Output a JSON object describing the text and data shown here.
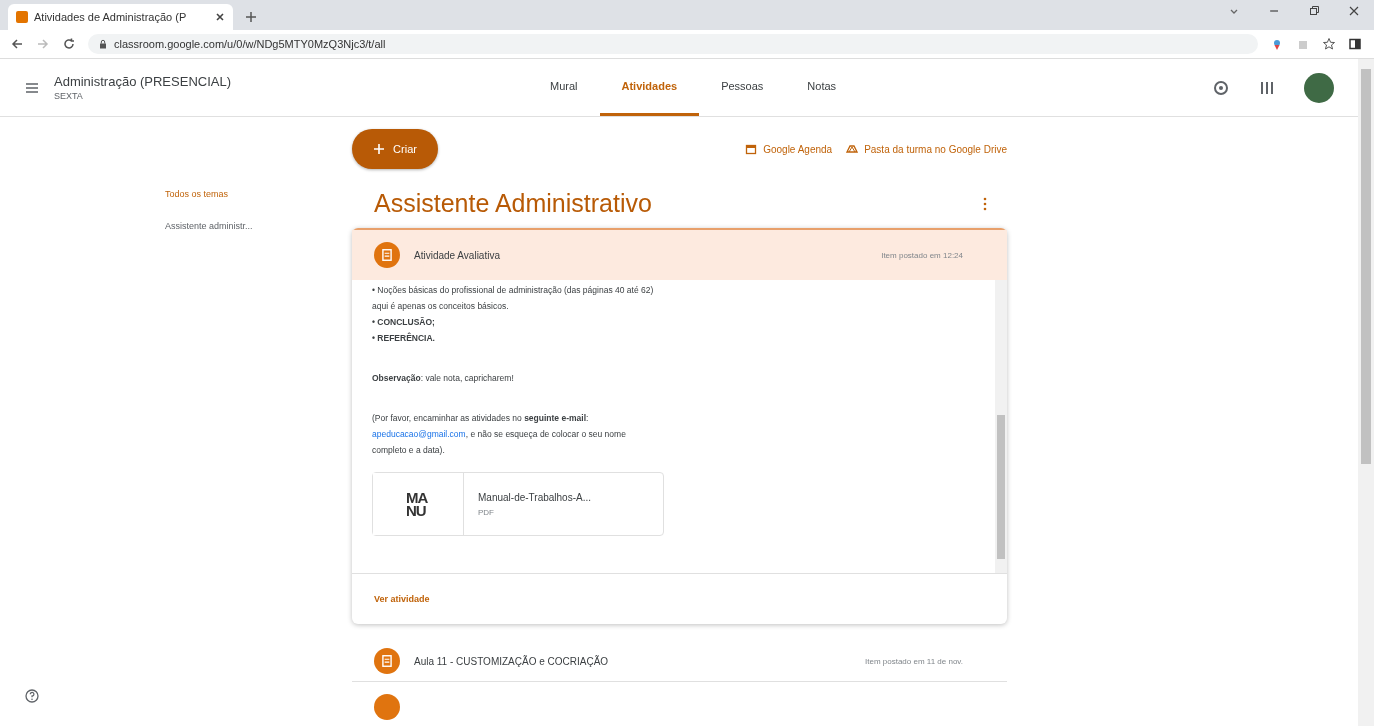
{
  "browser": {
    "tab_title": "Atividades de Administração (P",
    "url": "classroom.google.com/u/0/w/NDg5MTY0MzQ3Njc3/t/all"
  },
  "header": {
    "class_name": "Administração (PRESENCIAL)",
    "class_section": "SEXTA",
    "tabs": [
      {
        "label": "Mural",
        "selected": false
      },
      {
        "label": "Atividades",
        "selected": true
      },
      {
        "label": "Pessoas",
        "selected": false
      },
      {
        "label": "Notas",
        "selected": false
      }
    ]
  },
  "sidebar": {
    "items": [
      {
        "label": "Todos os temas",
        "selected": true
      },
      {
        "label": "Assistente administr...",
        "selected": false
      }
    ]
  },
  "toolbar": {
    "create_label": "Criar",
    "links": [
      "Google Agenda",
      "Pasta da turma no Google Drive"
    ]
  },
  "topic": {
    "title": "Assistente Administrativo",
    "open_item": {
      "title": "Atividade Avaliativa",
      "posted": "Item postado em 12:24",
      "body": [
        {
          "kind": "text",
          "text": "• Noções básicas do profissional de administração (das páginas 40 até 62)"
        },
        {
          "kind": "text",
          "text": "aqui é apenas os conceitos básicos."
        },
        {
          "kind": "text",
          "text": "**• CONCLUSÃO;**"
        },
        {
          "kind": "text",
          "text": "**• REFERÊNCIA.**"
        },
        {
          "kind": "gap"
        },
        {
          "kind": "text",
          "text": "**Observação**: vale nota, capricharem!"
        },
        {
          "kind": "gap"
        },
        {
          "kind": "text",
          "text": "(Por favor, encaminhar as atividades no **seguinte e-mail**:"
        },
        {
          "kind": "link",
          "link": "apeducacao@gmail.com",
          "text": ", e não se esqueça de colocar o seu nome"
        },
        {
          "kind": "text",
          "text": "completo e a data)."
        }
      ],
      "attachment": {
        "thumb_text": "MANU",
        "name": "Manual-de-Trabalhos-A...",
        "type": "PDF"
      },
      "view_label": "Ver atividade"
    },
    "items": [
      {
        "title": "Aula 11 - CUSTOMIZAÇÃO e COCRIAÇÃO",
        "posted": "Item postado em 11 de nov."
      }
    ]
  }
}
